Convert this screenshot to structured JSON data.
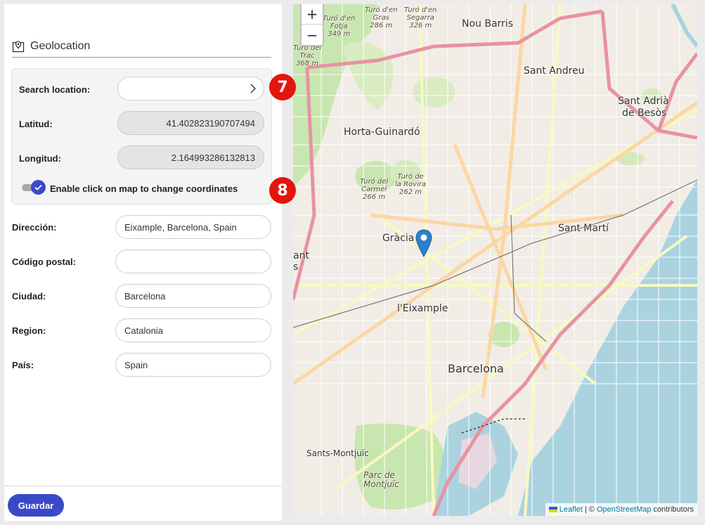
{
  "geolocation": {
    "title": "Geolocation",
    "search": {
      "label": "Search location:",
      "value": "",
      "placeholder": ""
    },
    "latitude": {
      "label": "Latitud:",
      "value": "41.402823190707494"
    },
    "longitude": {
      "label": "Longitud:",
      "value": "2.164993286132813"
    },
    "toggle": {
      "label": "Enable click on map to change coordinates",
      "checked": true
    }
  },
  "fields": {
    "direccion": {
      "label": "Dirección:",
      "value": "Eixample, Barcelona, Spain"
    },
    "codigo_postal": {
      "label": "Código postal:",
      "value": ""
    },
    "ciudad": {
      "label": "Ciudad:",
      "value": "Barcelona"
    },
    "region": {
      "label": "Region:",
      "value": "Catalonia"
    },
    "pais": {
      "label": "País:",
      "value": "Spain"
    }
  },
  "save_label": "Guardar",
  "badges": [
    "7",
    "8"
  ],
  "map": {
    "zoom_in": "+",
    "zoom_out": "−",
    "places": {
      "nou_barris": "Nou Barris",
      "sant_andreu": "Sant Andreu",
      "horta": "Horta-Guinardó",
      "sant_adria_1": "Sant Adrià",
      "sant_adria_2": "de Besòs",
      "gracia": "Gràcia",
      "sant_marti": "Sant Martí",
      "eixample": "l'Eixample",
      "barcelona": "Barcelona",
      "sants": "Sants-Montjuïc",
      "montjuic_1": "Parc de",
      "montjuic_2": "Montjuïc",
      "ant": "ant",
      "s": "s"
    },
    "peaks": {
      "fotja": [
        "Turó d'en",
        "Fotja",
        "349 m"
      ],
      "gras": [
        "Turó d'en",
        "Gras",
        "286 m"
      ],
      "segarra": [
        "Turó d'en",
        "Segarra",
        "326 m"
      ],
      "trac": [
        "Turó del",
        "Trac",
        "368 m"
      ],
      "carmel": [
        "Turó del",
        "Carmel",
        "266 m"
      ],
      "rovira": [
        "Turó de",
        "la Rovira",
        "262 m"
      ]
    },
    "attribution": {
      "leaflet": "Leaflet",
      "sep": "| ©",
      "osm": "OpenStreetMap",
      "contrib": "contributors"
    },
    "colors": {
      "sea": "#aad3df",
      "land": "#f1ede6",
      "park": "#c8e6b0",
      "motorway": "#e892a2",
      "primary": "#fcd6a4",
      "secondary": "#f7fabf",
      "marker": "#2a81cb"
    }
  }
}
